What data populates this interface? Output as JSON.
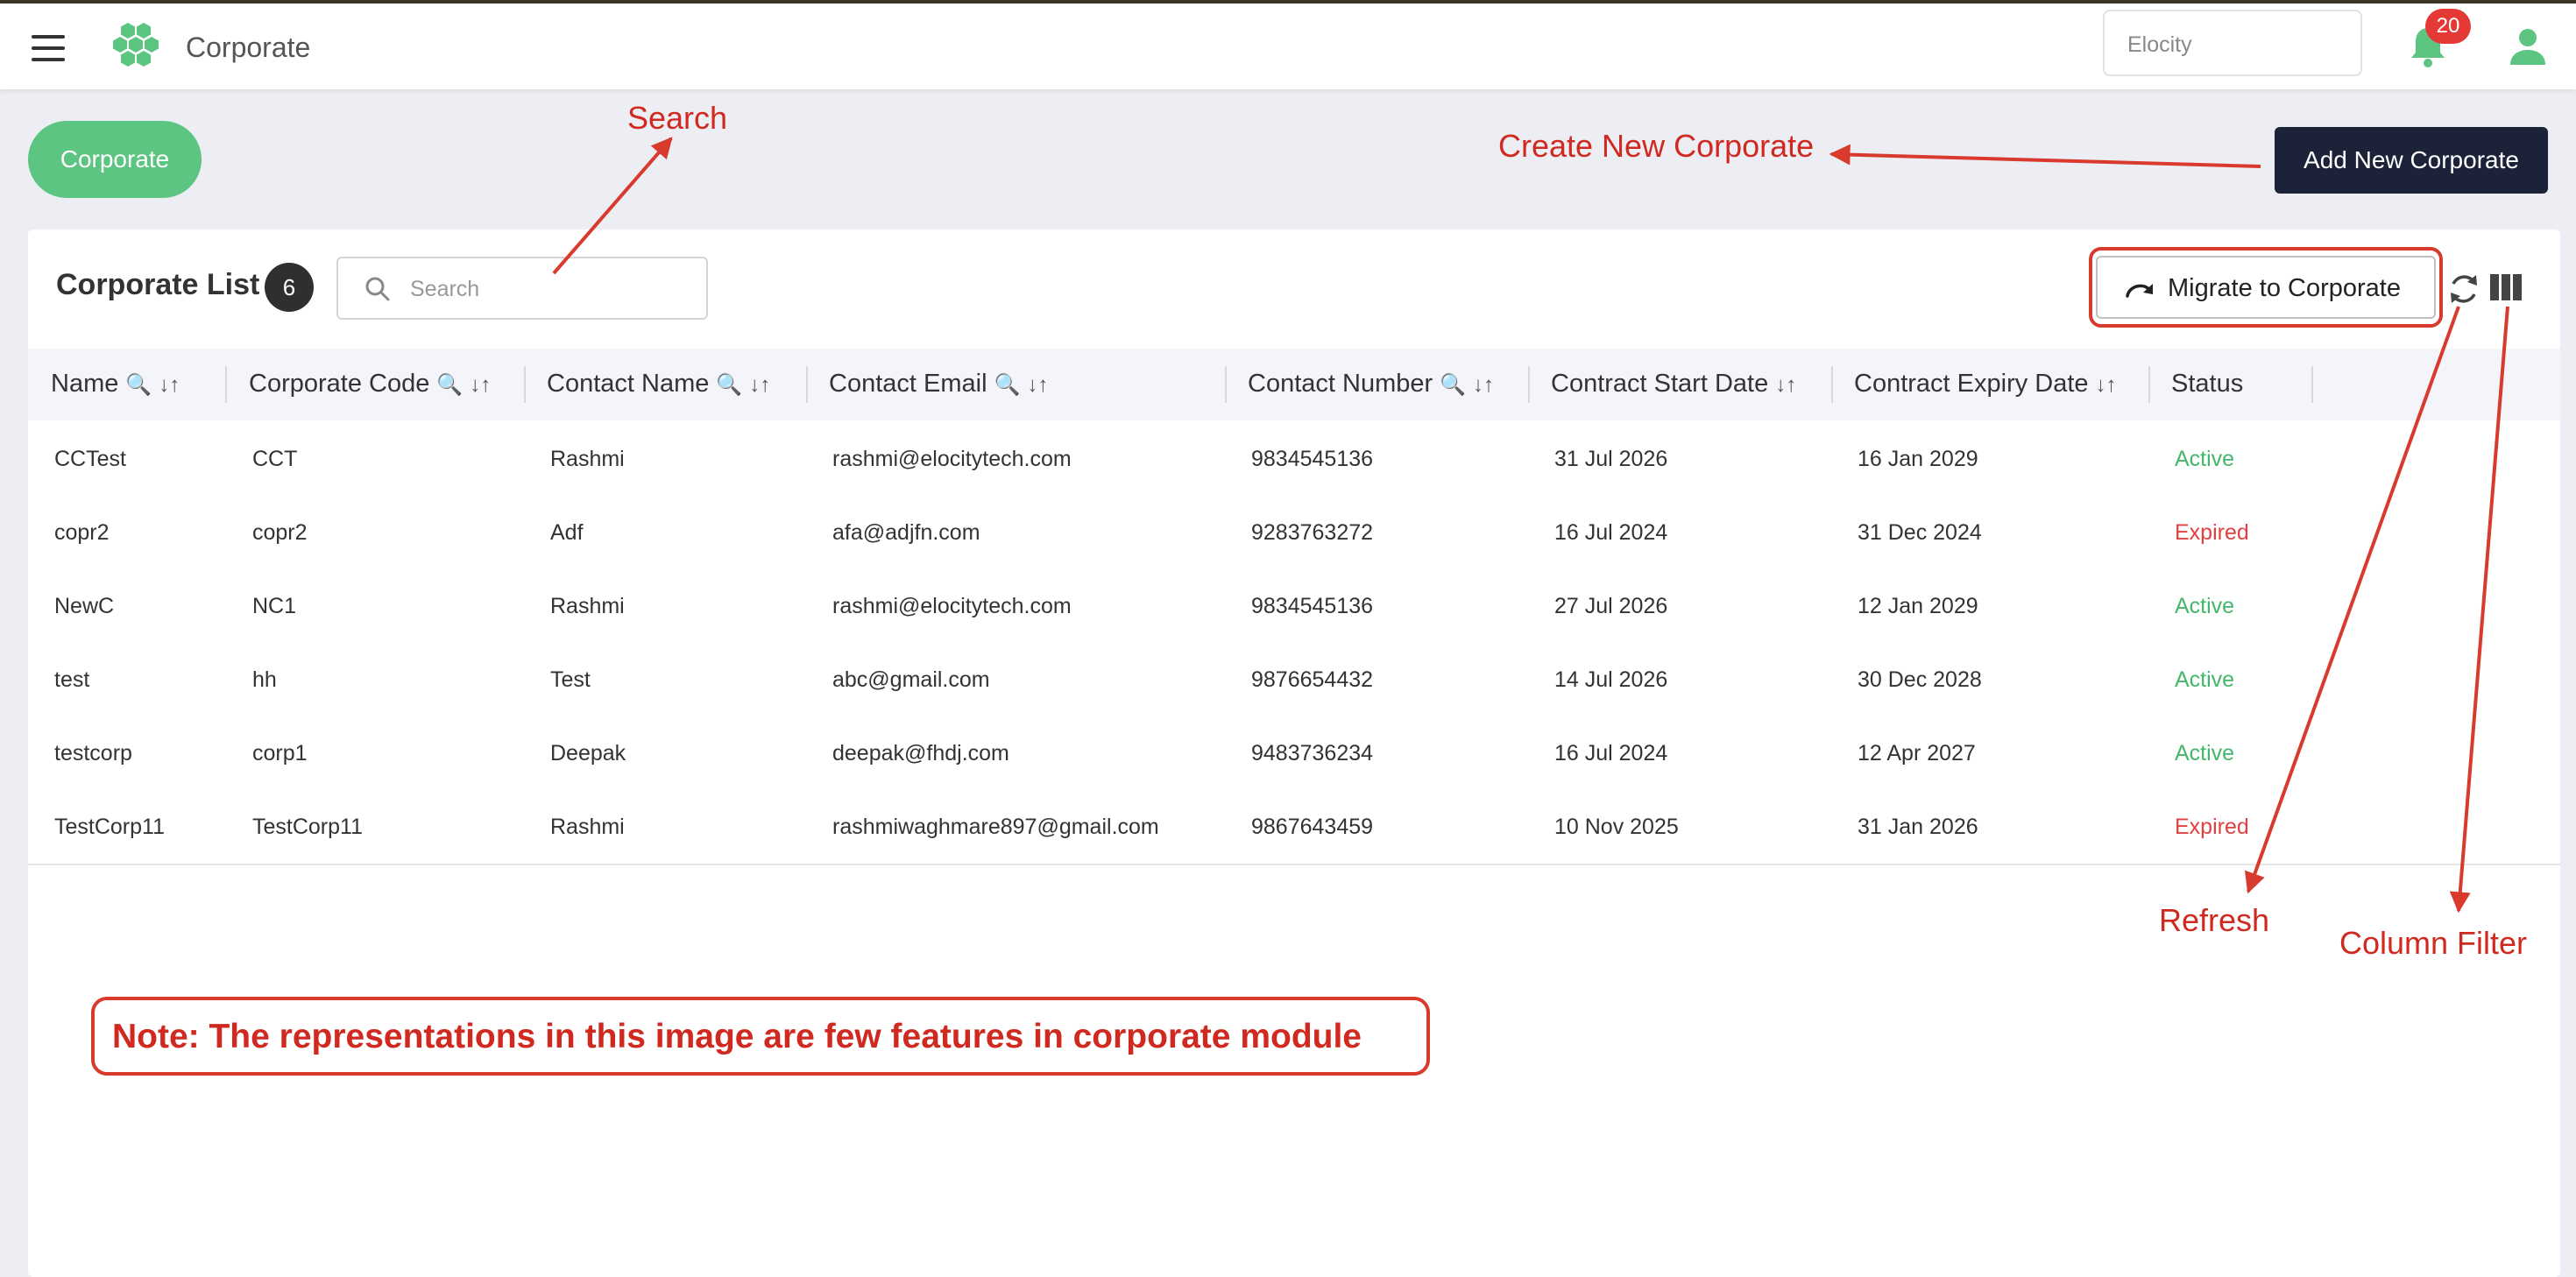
{
  "app": {
    "title": "Corporate",
    "tenant_placeholder": "Elocity",
    "notification_count": "20",
    "brand_color": "#5cc581"
  },
  "toolbar": {
    "tab_label": "Corporate",
    "add_label": "Add New Corporate"
  },
  "list": {
    "title": "Corporate List",
    "count": "6",
    "search_placeholder": "Search",
    "migrate_label": "Migrate to Corporate"
  },
  "columns": [
    {
      "label": "Name",
      "search": true,
      "sort": true
    },
    {
      "label": "Corporate Code",
      "search": true,
      "sort": true
    },
    {
      "label": "Contact Name",
      "search": true,
      "sort": true
    },
    {
      "label": "Contact Email",
      "search": true,
      "sort": true
    },
    {
      "label": "Contact Number",
      "search": true,
      "sort": true
    },
    {
      "label": "Contract Start Date",
      "search": false,
      "sort": true
    },
    {
      "label": "Contract Expiry Date",
      "search": false,
      "sort": true
    },
    {
      "label": "Status",
      "search": false,
      "sort": false
    }
  ],
  "icons": {
    "search": "🔍",
    "sort": "↓↑"
  },
  "rows": [
    {
      "name": "CCTest",
      "code": "CCT",
      "contact": "Rashmi",
      "email": "rashmi@elocitytech.com",
      "number": "9834545136",
      "start": "31 Jul 2026",
      "expiry": "16 Jan 2029",
      "status": "Active"
    },
    {
      "name": "copr2",
      "code": "copr2",
      "contact": "Adf",
      "email": "afa@adjfn.com",
      "number": "9283763272",
      "start": "16 Jul 2024",
      "expiry": "31 Dec 2024",
      "status": "Expired"
    },
    {
      "name": "NewC",
      "code": "NC1",
      "contact": "Rashmi",
      "email": "rashmi@elocitytech.com",
      "number": "9834545136",
      "start": "27 Jul 2026",
      "expiry": "12 Jan 2029",
      "status": "Active"
    },
    {
      "name": "test",
      "code": "hh",
      "contact": "Test",
      "email": "abc@gmail.com",
      "number": "9876654432",
      "start": "14 Jul 2026",
      "expiry": "30 Dec 2028",
      "status": "Active"
    },
    {
      "name": "testcorp",
      "code": "corp1",
      "contact": "Deepak",
      "email": "deepak@fhdj.com",
      "number": "9483736234",
      "start": "16 Jul 2024",
      "expiry": "12 Apr 2027",
      "status": "Active"
    },
    {
      "name": "TestCorp11",
      "code": "TestCorp11",
      "contact": "Rashmi",
      "email": "rashmiwaghmare897@gmail.com",
      "number": "9867643459",
      "start": "10 Nov 2025",
      "expiry": "31 Jan 2026",
      "status": "Expired"
    }
  ],
  "annotations": {
    "search": "Search",
    "create": "Create New Corporate",
    "refresh": "Refresh",
    "column_filter": "Column Filter",
    "note": "Note: The representations in this image are few features in corporate module",
    "color": "#d0291f"
  }
}
